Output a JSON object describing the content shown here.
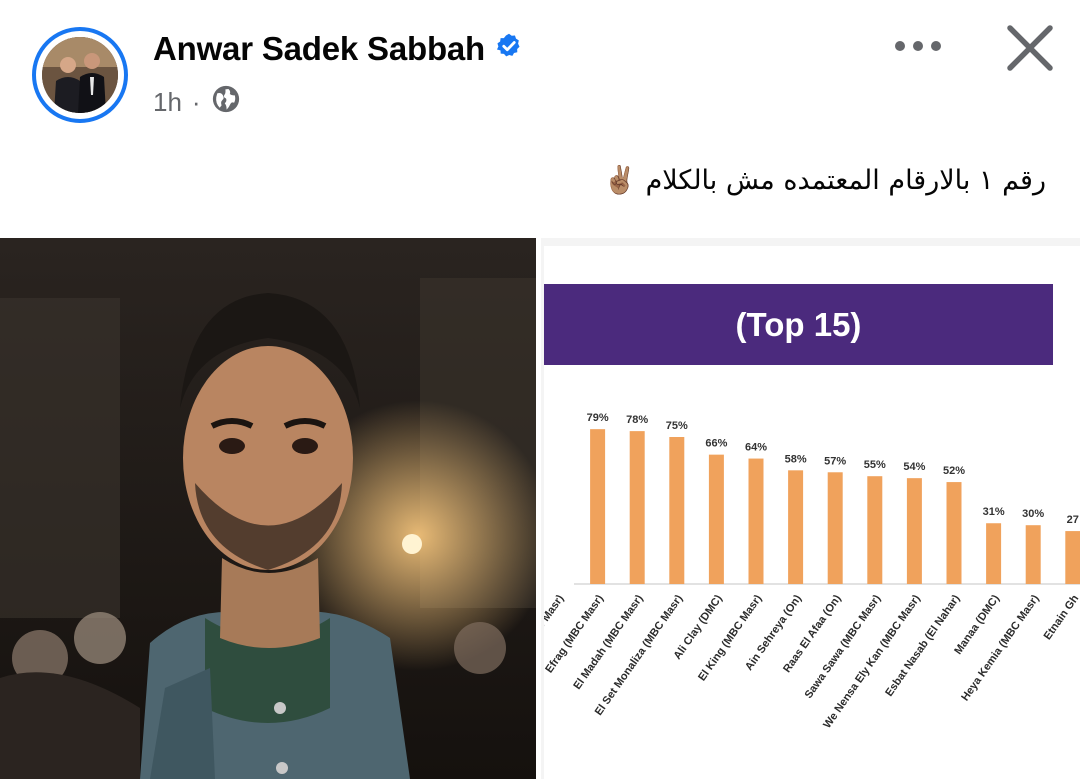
{
  "post": {
    "author": "Anwar Sadek Sabbah",
    "time": "1h",
    "caption": "رقم ١ بالارقام المعتمده مش بالكلام ✌🏽"
  },
  "colors": {
    "verified": "#1877f2",
    "banner": "#4b2a7d",
    "bar": "#f0a25c"
  },
  "icons": {
    "verified": "verified-badge-icon",
    "privacy": "globe-icon",
    "more": "more-options-icon",
    "close": "close-icon"
  },
  "chart_data": {
    "type": "bar",
    "title": "(Top 15)",
    "categories": [
      "(MBC Masr)",
      "Efrag (MBC Masr)",
      "El Madah (MBC Masr)",
      "El Set Monaliza (MBC Masr)",
      "Ali Clay (DMC)",
      "El King (MBC Masr)",
      "Ain Sehreya (On)",
      "Raas El Afaa (On)",
      "Sawa Sawa (MBC Masr)",
      "We Nensa Ely Kan (MBC Masr)",
      "Esbat Nasab (El Nahar)",
      "Manaa (DMC)",
      "Heya Kemia (MBC Masr)",
      "Etnain Gh"
    ],
    "values": [
      null,
      79,
      78,
      75,
      66,
      64,
      58,
      57,
      55,
      54,
      52,
      31,
      30,
      27
    ],
    "data_labels": [
      "",
      "79%",
      "78%",
      "75%",
      "66%",
      "64%",
      "58%",
      "57%",
      "55%",
      "54%",
      "52%",
      "31%",
      "30%",
      "27"
    ],
    "grid": false
  }
}
